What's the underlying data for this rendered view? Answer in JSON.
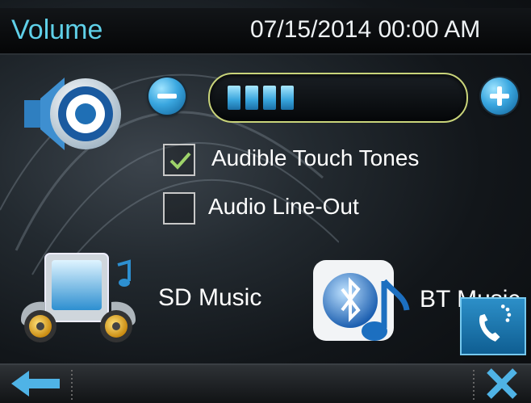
{
  "header": {
    "title": "Volume",
    "datetime": "07/15/2014 00:00 AM"
  },
  "volume": {
    "level": 4,
    "max": 10
  },
  "options": [
    {
      "label": "Audible Touch Tones",
      "checked": true
    },
    {
      "label": "Audio Line-Out",
      "checked": false
    }
  ],
  "sources": [
    {
      "label": "SD Music",
      "icon": "sd-music-icon"
    },
    {
      "label": "BT Music",
      "icon": "bluetooth-music-icon"
    }
  ],
  "toolbar": {
    "back_icon": "back-arrow-icon",
    "close_icon": "close-icon",
    "phone_icon": "phone-icon"
  },
  "colors": {
    "title": "#5fd0e8",
    "accent": "#37a4dc",
    "track_border": "#c9d47a"
  }
}
